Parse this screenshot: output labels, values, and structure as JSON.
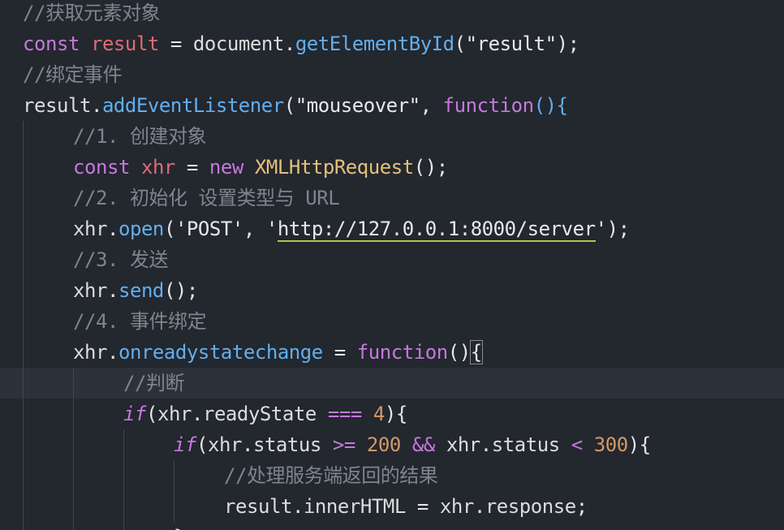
{
  "editor": {
    "lines": [
      {
        "c1": "//获取元素对象"
      },
      {
        "kw": "const",
        "var": "result",
        "eq": "=",
        "obj": "document",
        "dot": ".",
        "fn": "getElementById",
        "open": "(",
        "str": "\"result\"",
        "close": ");"
      },
      {
        "c1": "//绑定事件"
      },
      {
        "obj": "result",
        "dot": ".",
        "fn": "addEventListener",
        "open": "(",
        "str": "\"mouseover\"",
        "comma": ",",
        "kw": "function",
        "tail": "(){"
      },
      {
        "c1": "//1. 创建对象"
      },
      {
        "kw1": "const",
        "var": "xhr",
        "eq": "=",
        "kw2": "new",
        "cls": "XMLHttpRequest",
        "tail": "();"
      },
      {
        "c1": "//2. 初始化 设置类型与 URL"
      },
      {
        "obj": "xhr",
        "dot": ".",
        "fn": "open",
        "open": "(",
        "s1": "'POST'",
        "comma": ",",
        "q1": "'",
        "url": "http://127.0.0.1:8000/server",
        "q2": "'",
        "close": ");"
      },
      {
        "c1": "//3. 发送"
      },
      {
        "obj": "xhr",
        "dot": ".",
        "fn": "send",
        "tail": "();"
      },
      {
        "c1": "//4. 事件绑定"
      },
      {
        "obj": "xhr",
        "dot": ".",
        "prop": "onreadystatechange",
        "eq": "=",
        "kw": "function",
        "tail": "()",
        "brace": "{"
      },
      {
        "c1": "//判断"
      },
      {
        "kw": "if",
        "open": "(",
        "obj": "xhr",
        "dot": ".",
        "prop": "readyState",
        "op": "===",
        "num": "4",
        "tail": "){"
      },
      {
        "kw": "if",
        "open": "(",
        "obj1": "xhr",
        "dot1": ".",
        "prop1": "status",
        "op1": ">=",
        "num1": "200",
        "and": "&&",
        "obj2": "xhr",
        "dot2": ".",
        "prop2": "status",
        "op2": "<",
        "num2": "300",
        "tail": "){"
      },
      {
        "c1": "//处理服务端返回的结果"
      },
      {
        "obj1": "result",
        "dot1": ".",
        "prop": "innerHTML",
        "eq": "=",
        "obj2": "xhr",
        "dot2": ".",
        "prop2": "response",
        "semi": ";"
      },
      {
        "tail": "}"
      }
    ]
  }
}
